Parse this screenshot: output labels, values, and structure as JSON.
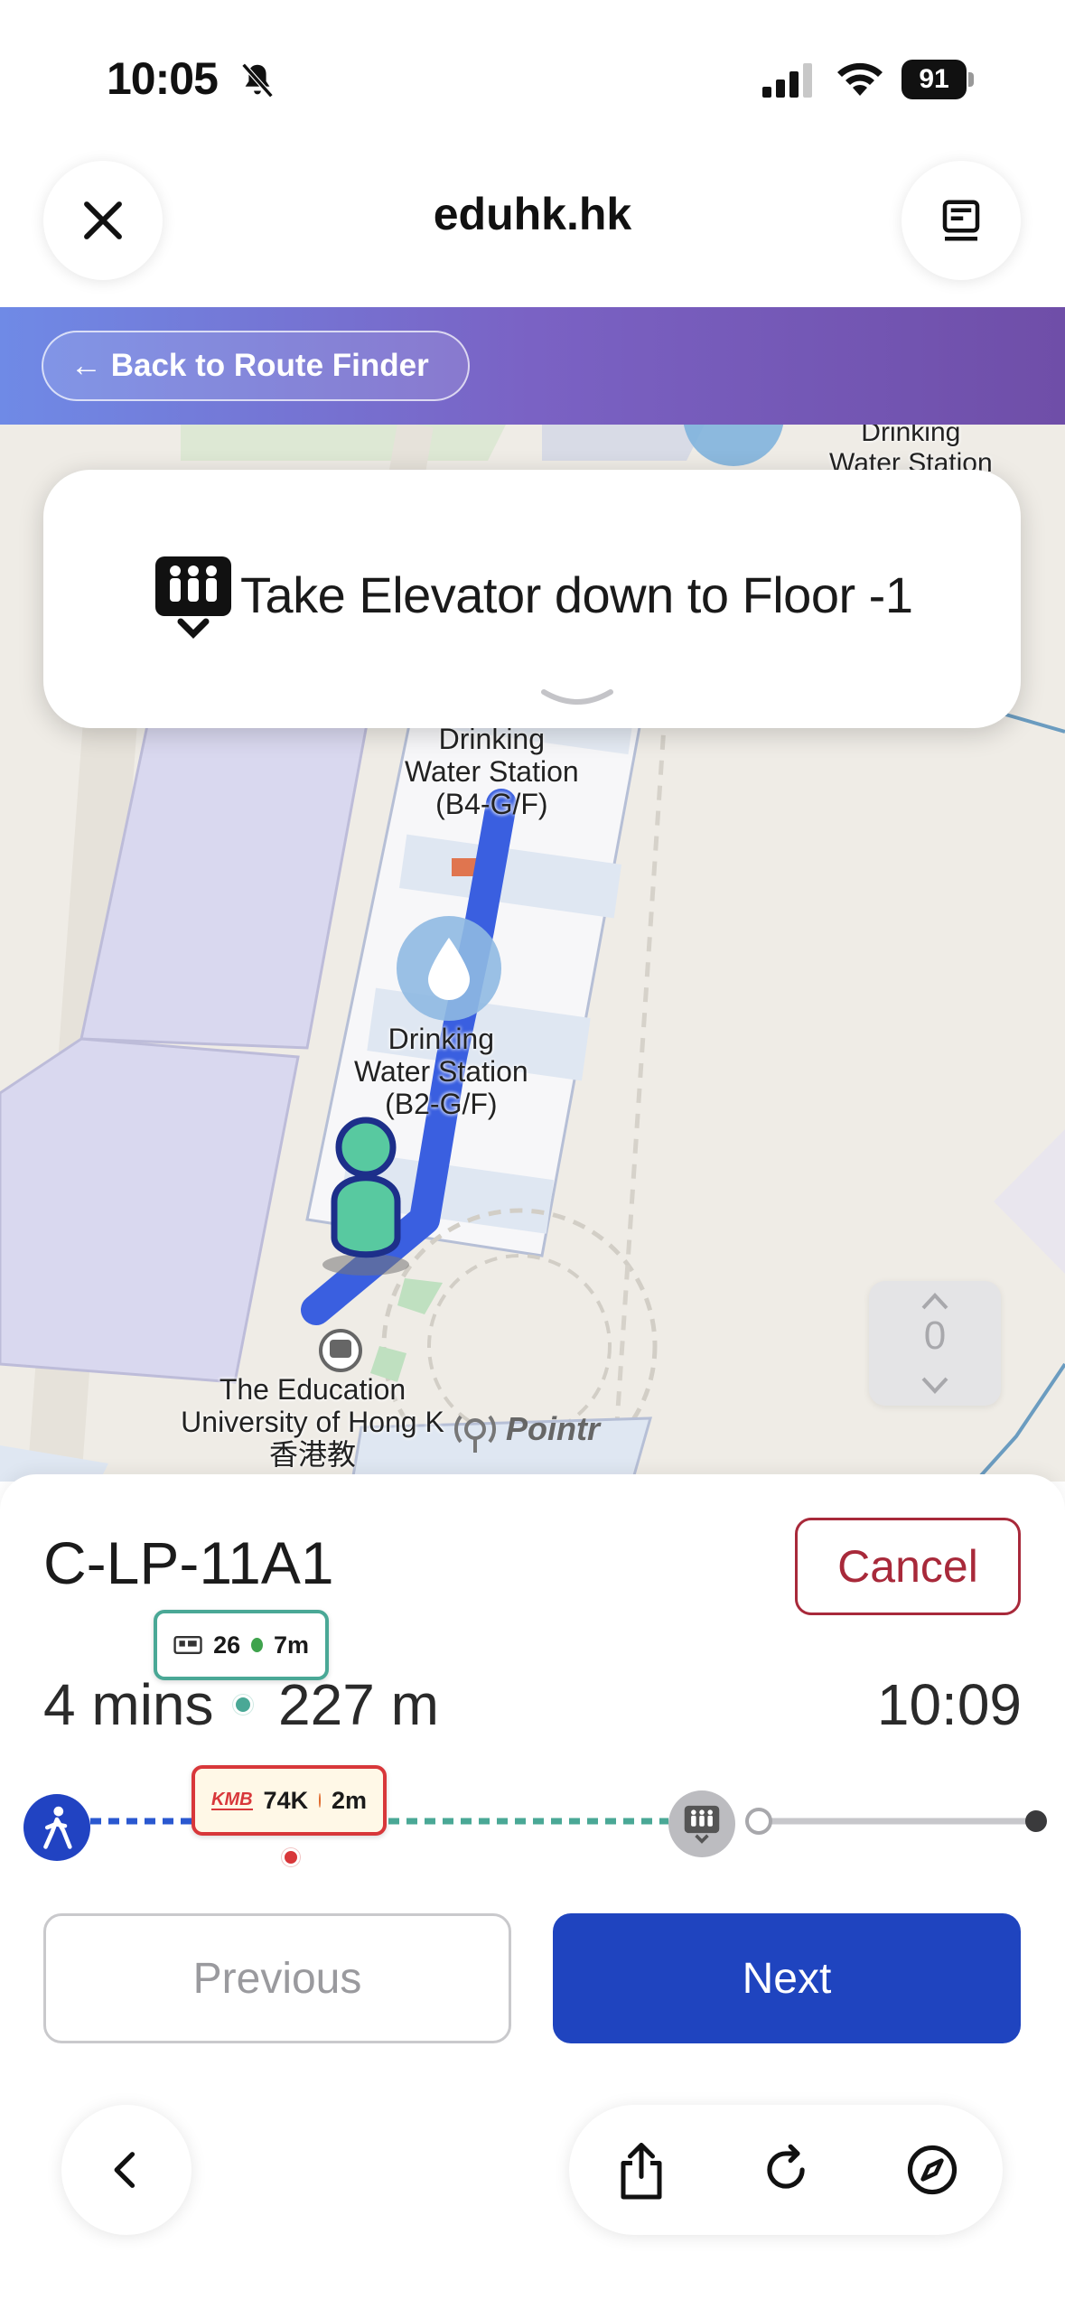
{
  "status_bar": {
    "time": "10:05",
    "battery": "91"
  },
  "browser": {
    "site_title": "eduhk.hk"
  },
  "header": {
    "back_label": "← Back to Route Finder"
  },
  "map": {
    "labels": {
      "drinking_top": "Drinking\nWater Station",
      "drinking_b4": "Drinking\nWater Station\n(B4-G/F)",
      "drinking_b2": "Drinking\nWater Station\n(B2-G/F)",
      "campus": "The Education\nUniversity of Hong K\n香港教"
    },
    "floor_level": "0",
    "attribution": "Pointr"
  },
  "instruction": {
    "text": "Take Elevator down to Floor -1"
  },
  "route": {
    "name": "C-LP-11A1",
    "cancel_label": "Cancel",
    "duration": "4 mins",
    "distance": "227 m",
    "eta": "10:09",
    "bus_badge": {
      "route": "26",
      "time": "7m",
      "dot_color": "#3fa34d"
    },
    "kmb_badge": {
      "logo": "KMB",
      "route": "74K",
      "time": "2m",
      "dot_color": "#e0682b"
    },
    "previous_label": "Previous",
    "next_label": "Next"
  },
  "colors": {
    "accent_blue": "#1f44bf",
    "cancel_red": "#a8293a",
    "route_path": "#3a5fe0",
    "teal": "#4aa896"
  }
}
